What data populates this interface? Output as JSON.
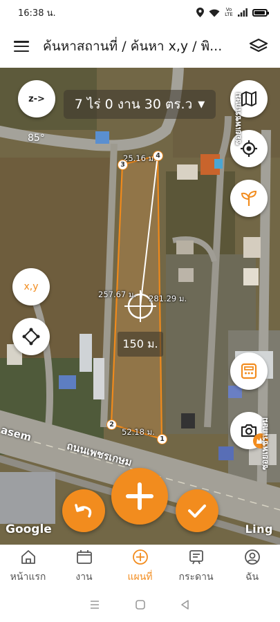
{
  "status_bar": {
    "time": "16:38 น.",
    "icons": [
      "location-icon",
      "wifi-icon",
      "signal-icon",
      "battery-icon"
    ],
    "network": "Vo LTE",
    "battery_level": 0.85
  },
  "app_bar": {
    "title": "ค้นหาสถานที่ / ค้นหา x,y / พิ...",
    "menu_icon": "menu-icon",
    "layers_icon": "layers-icon"
  },
  "map": {
    "area_text": "7 ไร่ 0 งาน 30 ตร.ว",
    "compass_button": "z->",
    "compass_angle": "85°",
    "xy_button": "x,y",
    "segment_labels": {
      "top": "25.16 ม.",
      "left": "257.67 ม.",
      "right": "281.29 ม.",
      "bottom": "52.18 ม."
    },
    "vertices": [
      "1",
      "2",
      "3",
      "4"
    ],
    "distance": "150 ม.",
    "road_name": "ถนนเพชรเกษม",
    "road_name_en": "asem",
    "side_road_top": "ซอยเพชรเกษม",
    "side_road_bottom": "ซอยเพชรเกษม",
    "attribution": "Google",
    "brand": "Ling"
  },
  "colors": {
    "accent": "#f28c1e",
    "plot_outline": "#f08a1c"
  },
  "bottom_nav": [
    {
      "label": "หน้าแรก",
      "icon": "home-icon"
    },
    {
      "label": "งาน",
      "icon": "calendar-icon"
    },
    {
      "label": "แผนที่",
      "icon": "map-plus-icon",
      "active": true
    },
    {
      "label": "กระดาน",
      "icon": "board-icon"
    },
    {
      "label": "ฉัน",
      "icon": "profile-icon"
    }
  ]
}
